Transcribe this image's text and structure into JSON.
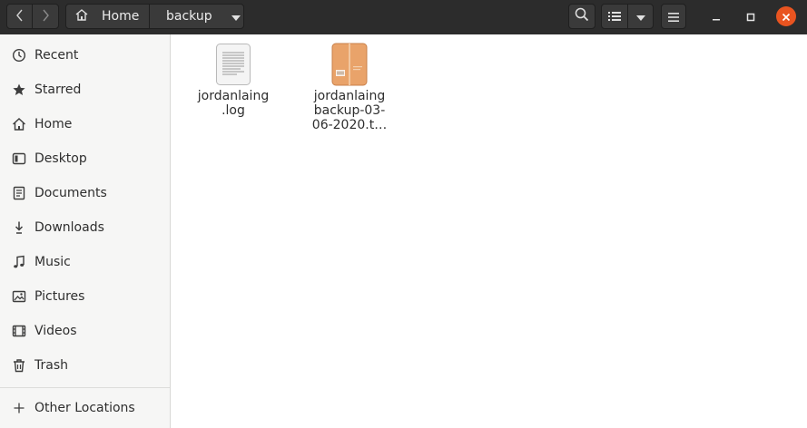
{
  "header": {
    "breadcrumbs": [
      {
        "label": "Home",
        "icon": "home-icon"
      },
      {
        "label": "backup"
      }
    ]
  },
  "sidebar": {
    "items": [
      {
        "label": "Recent",
        "icon": "clock-icon"
      },
      {
        "label": "Starred",
        "icon": "star-icon"
      },
      {
        "label": "Home",
        "icon": "home-icon"
      },
      {
        "label": "Desktop",
        "icon": "desktop-icon"
      },
      {
        "label": "Documents",
        "icon": "document-icon"
      },
      {
        "label": "Downloads",
        "icon": "download-icon"
      },
      {
        "label": "Music",
        "icon": "music-icon"
      },
      {
        "label": "Pictures",
        "icon": "picture-icon"
      },
      {
        "label": "Videos",
        "icon": "video-icon"
      },
      {
        "label": "Trash",
        "icon": "trash-icon"
      }
    ],
    "other_locations": {
      "label": "Other Locations",
      "icon": "plus-icon"
    }
  },
  "files": [
    {
      "name": "jordanlaing\n.log",
      "icon": "text-file-icon"
    },
    {
      "name": "jordanlaing\nbackup-03-\n06-2020.t…",
      "icon": "archive-file-icon"
    }
  ],
  "colors": {
    "headerbar": "#2c2c2c",
    "close_button": "#e95420",
    "sidebar": "#f6f6f5",
    "archive": "#e9a36a"
  }
}
